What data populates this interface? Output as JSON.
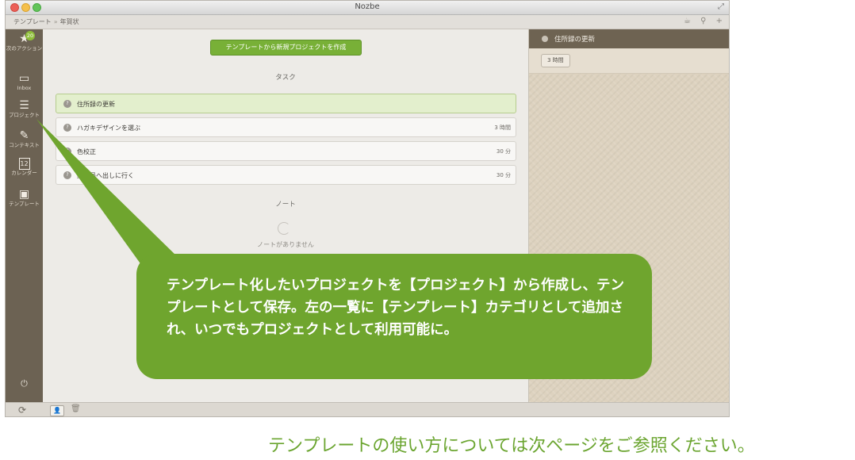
{
  "window": {
    "title": "Nozbe"
  },
  "toolbar": {
    "breadcrumb_root": "テンプレート",
    "breadcrumb_sep": "»",
    "breadcrumb_current": "年賀状"
  },
  "sidebar": {
    "badge": "20",
    "items": [
      {
        "label": "次のアクション"
      },
      {
        "label": "Inbox"
      },
      {
        "label": "プロジェクト"
      },
      {
        "label": "コンテキスト"
      },
      {
        "label": "カレンダー",
        "icon_text": "12"
      },
      {
        "label": "テンプレート"
      }
    ]
  },
  "main": {
    "create_button": "テンプレートから新規プロジェクトを作成",
    "tasks_title": "タスク",
    "tasks": [
      {
        "name": "住所録の更新",
        "time": ""
      },
      {
        "name": "ハガキデザインを選ぶ",
        "time": "3 時間"
      },
      {
        "name": "色校正",
        "time": "30 分"
      },
      {
        "name": "郵便局へ出しに行く",
        "time": "30 分"
      }
    ],
    "notes_title": "ノート",
    "no_notes": "ノートがありません"
  },
  "detail": {
    "title": "住所録の更新",
    "time": "3 時間"
  },
  "callout": {
    "text": "テンプレート化したいプロジェクトを【プロジェクト】から作成し、テンプレートとして保存。左の一覧に【テンプレート】カテゴリとして追加され、いつでもプロジェクトとして利用可能に。"
  },
  "footer": {
    "text": "テンプレートの使い方については次ページをご参照ください。"
  },
  "colors": {
    "accent_green": "#78b037",
    "callout_green": "#6fa52e",
    "sidebar": "#6c6253"
  }
}
